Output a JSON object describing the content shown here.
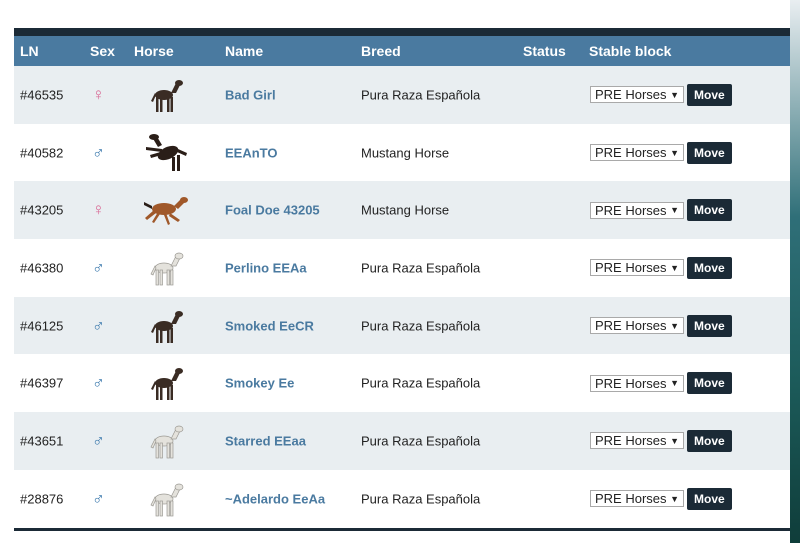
{
  "table": {
    "headers": {
      "ln": "LN",
      "sex": "Sex",
      "horse": "Horse",
      "name": "Name",
      "breed": "Breed",
      "status": "Status",
      "stable_block": "Stable block"
    },
    "rows": [
      {
        "ln": "#46535",
        "sex": "♀",
        "sex_type": "female",
        "horse_icon": "dark-foal-icon",
        "name": "Bad Girl",
        "breed": "Pura Raza Española",
        "status": "",
        "stable": "PRE Horses",
        "action": "Move"
      },
      {
        "ln": "#40582",
        "sex": "♂",
        "sex_type": "male",
        "horse_icon": "rearing-dark-horse-icon",
        "name": "EEAnTO",
        "breed": "Mustang Horse",
        "status": "",
        "stable": "PRE Horses",
        "action": "Move"
      },
      {
        "ln": "#43205",
        "sex": "♀",
        "sex_type": "female",
        "horse_icon": "galloping-bay-horse-icon",
        "name": "Foal Doe 43205",
        "breed": "Mustang Horse",
        "status": "",
        "stable": "PRE Horses",
        "action": "Move"
      },
      {
        "ln": "#46380",
        "sex": "♂",
        "sex_type": "male",
        "horse_icon": "light-foal-icon",
        "name": "Perlino EEAa",
        "breed": "Pura Raza Española",
        "status": "",
        "stable": "PRE Horses",
        "action": "Move"
      },
      {
        "ln": "#46125",
        "sex": "♂",
        "sex_type": "male",
        "horse_icon": "dark-foal-icon",
        "name": "Smoked EeCR",
        "breed": "Pura Raza Española",
        "status": "",
        "stable": "PRE Horses",
        "action": "Move"
      },
      {
        "ln": "#46397",
        "sex": "♂",
        "sex_type": "male",
        "horse_icon": "dark-foal-icon",
        "name": "Smokey Ee",
        "breed": "Pura Raza Española",
        "status": "",
        "stable": "PRE Horses",
        "action": "Move"
      },
      {
        "ln": "#43651",
        "sex": "♂",
        "sex_type": "male",
        "horse_icon": "light-foal-icon",
        "name": "Starred EEaa",
        "breed": "Pura Raza Española",
        "status": "",
        "stable": "PRE Horses",
        "action": "Move"
      },
      {
        "ln": "#28876",
        "sex": "♂",
        "sex_type": "male",
        "horse_icon": "light-foal-icon",
        "name": "~Adelardo EeAa",
        "breed": "Pura Raza Española",
        "status": "",
        "stable": "PRE Horses",
        "action": "Move"
      }
    ]
  },
  "colors": {
    "header_bg": "#4a7aa0",
    "row_alt_bg": "#e9eef1",
    "name_link": "#4a7aa0",
    "female": "#d86a96",
    "male": "#3b79ad",
    "button_bg": "#1b2a36"
  }
}
